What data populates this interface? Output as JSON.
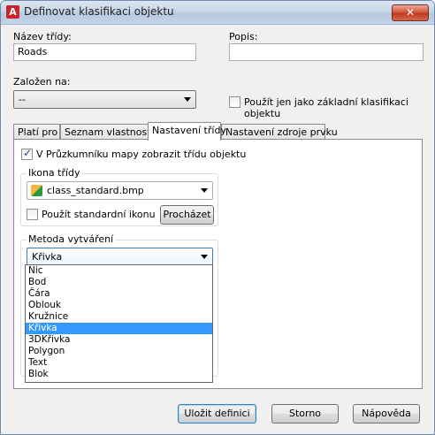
{
  "window": {
    "title": "Definovat klasifikaci objektu",
    "app_icon_letter": "A",
    "close_symbol": "✕"
  },
  "fields": {
    "class_name_label": "Název třídy:",
    "class_name_value": "Roads",
    "description_label": "Popis:",
    "description_value": "",
    "based_on_label": "Založen na:",
    "based_on_value": "--",
    "base_only_label": "Použít jen jako základní klasifikaci objektu"
  },
  "tabs": [
    {
      "label": "Platí pro"
    },
    {
      "label": "Seznam vlastností"
    },
    {
      "label": "Nastavení třídy"
    },
    {
      "label": "Nastavení zdroje prvku"
    }
  ],
  "class_settings": {
    "show_in_explorer_label": "V Průzkumníku mapy zobrazit třídu objektu",
    "icon_group_title": "Ikona třídy",
    "icon_file": "class_standard.bmp",
    "use_standard_icon_label": "Použít standardní ikonu",
    "browse_label": "Procházet",
    "creation_group_title": "Metoda vytváření",
    "creation_value": "Křivka",
    "creation_options": [
      "Nic",
      "Bod",
      "Čára",
      "Oblouk",
      "Kružnice",
      "Křivka",
      "3DKřivka",
      "Polygon",
      "Text",
      "Blok"
    ],
    "selected_option_index": 5
  },
  "buttons": {
    "save": "Uložit definici",
    "cancel": "Storno",
    "help": "Nápověda"
  },
  "colors": {
    "selection": "#3399ff",
    "close_button": "#c13a1f"
  }
}
